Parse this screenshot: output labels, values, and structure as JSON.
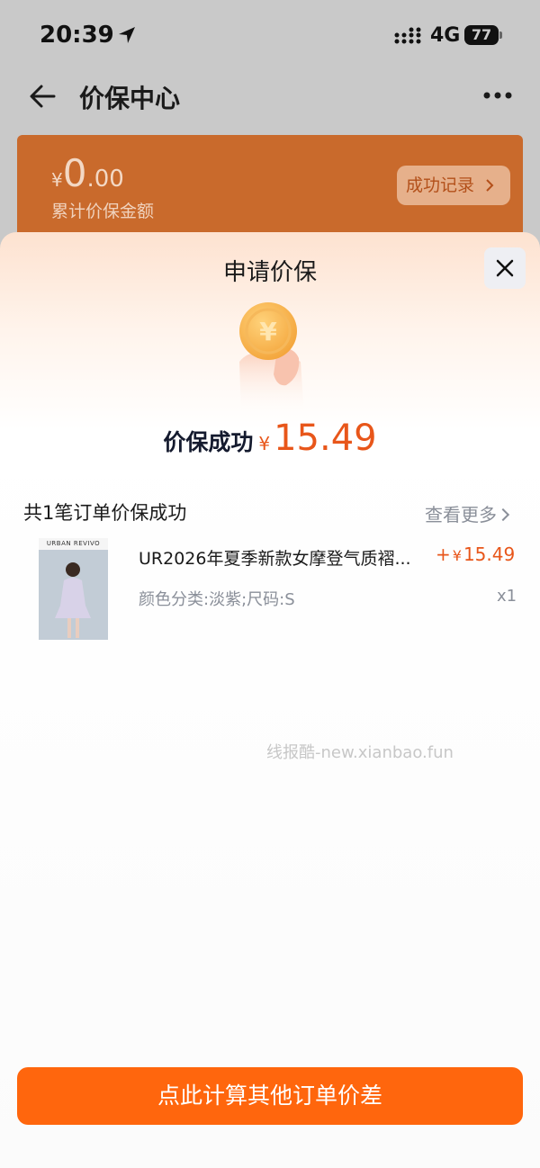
{
  "status_bar": {
    "time": "20:39",
    "network": "4G",
    "battery": "77"
  },
  "nav": {
    "title": "价保中心"
  },
  "summary": {
    "currency": "¥",
    "amount_int": "0",
    "amount_dec": ".00",
    "label": "累计价保金额",
    "records_button": "成功记录"
  },
  "sheet": {
    "title": "申请价保",
    "result_label": "价保成功",
    "result_currency": "¥",
    "result_amount": "15.49",
    "order_count": "共1笔订单价保成功",
    "more_link": "查看更多"
  },
  "order_item": {
    "thumb_brand": "URBAN REVIVO",
    "title": "UR2026年夏季新款女摩登气质褶...",
    "price_sign": "+",
    "currency": "¥",
    "price": "15.49",
    "spec": "颜色分类:淡紫;尺码:S",
    "quantity": "x1"
  },
  "watermark": "线报酷-new.xianbao.fun",
  "cta_button": "点此计算其他订单价差",
  "colors": {
    "accent": "#ff660d",
    "price": "#e8561a",
    "card": "#c96a2c"
  }
}
